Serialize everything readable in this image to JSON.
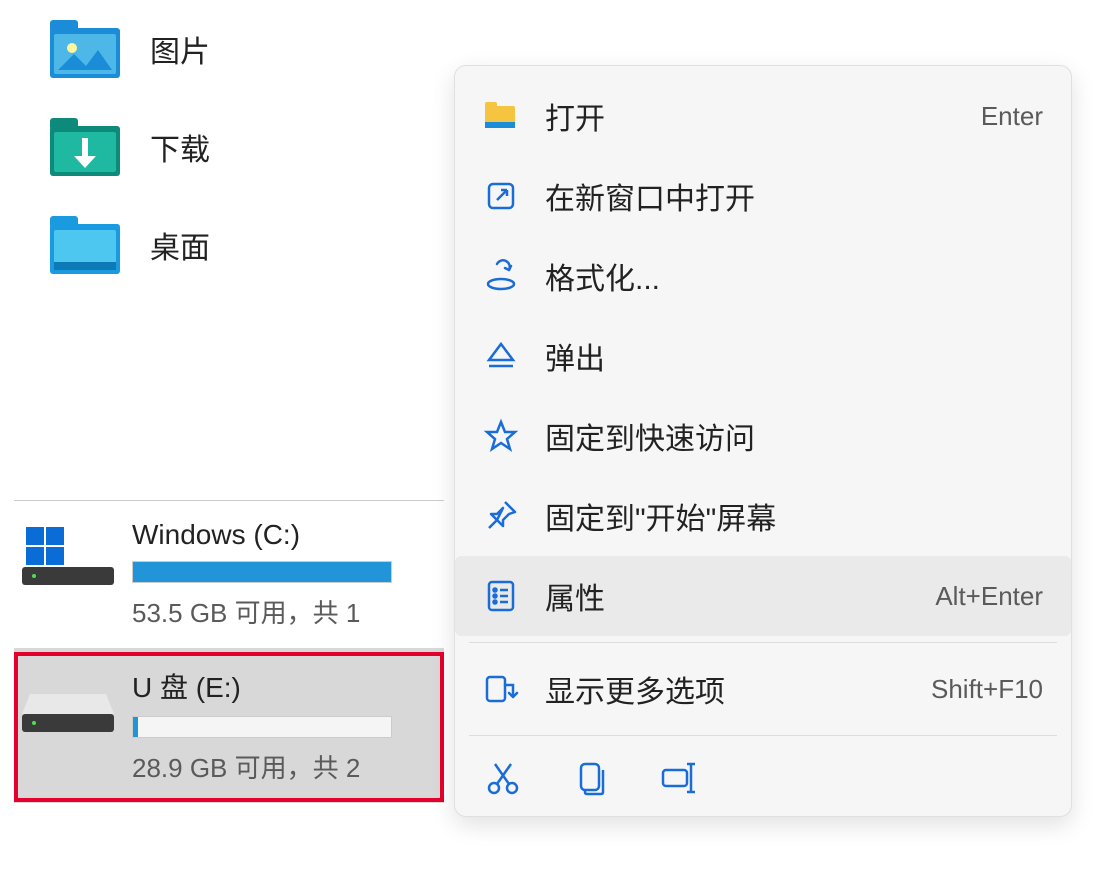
{
  "sidebar": {
    "folders": [
      {
        "label": "图片",
        "icon": "pictures"
      },
      {
        "label": "下载",
        "icon": "downloads"
      },
      {
        "label": "桌面",
        "icon": "desktop"
      }
    ]
  },
  "drives": [
    {
      "name": "Windows (C:)",
      "status": "53.5 GB 可用，共 1",
      "fill_pct": 100,
      "selected": false,
      "logo": true
    },
    {
      "name": "U 盘 (E:)",
      "status": "28.9 GB 可用，共 2",
      "fill_pct": 2,
      "selected": true,
      "logo": false
    }
  ],
  "context_menu": {
    "items": [
      {
        "label": "打开",
        "shortcut": "Enter",
        "icon": "folder-open"
      },
      {
        "label": "在新窗口中打开",
        "shortcut": "",
        "icon": "new-window"
      },
      {
        "label": "格式化...",
        "shortcut": "",
        "icon": "format"
      },
      {
        "label": "弹出",
        "shortcut": "",
        "icon": "eject",
        "highlight": true
      },
      {
        "label": "固定到快速访问",
        "shortcut": "",
        "icon": "star"
      },
      {
        "label": "固定到\"开始\"屏幕",
        "shortcut": "",
        "icon": "pin"
      },
      {
        "label": "属性",
        "shortcut": "Alt+Enter",
        "icon": "properties",
        "hover": true
      },
      {
        "label": "显示更多选项",
        "shortcut": "Shift+F10",
        "icon": "more",
        "sep_before": true
      }
    ],
    "toolbar": [
      "cut",
      "copy",
      "rename"
    ]
  }
}
